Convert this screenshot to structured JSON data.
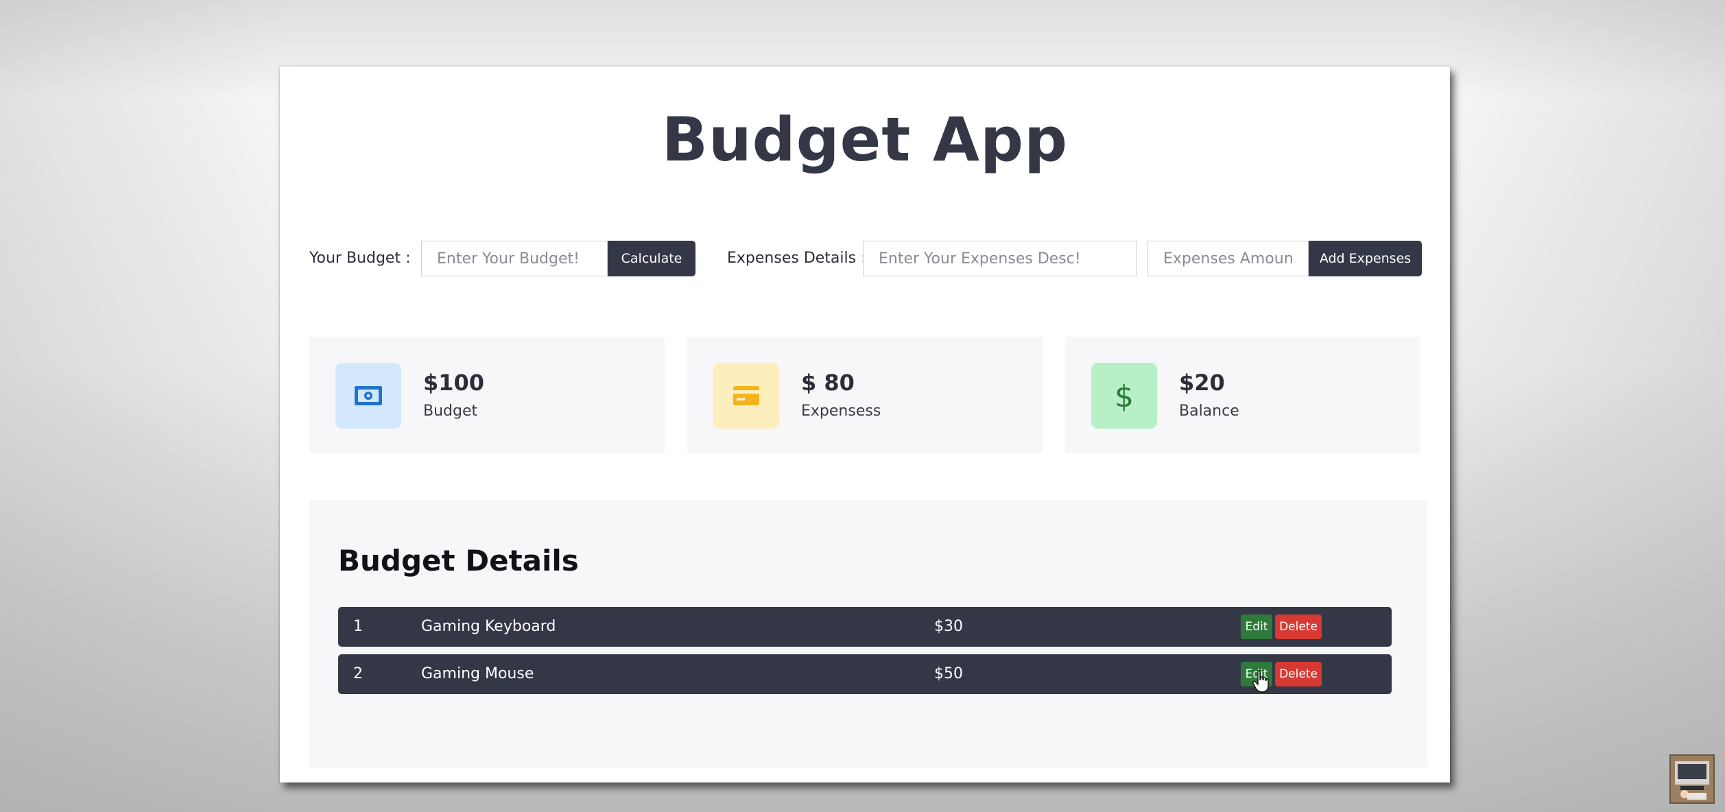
{
  "app": {
    "title": "Budget App"
  },
  "form": {
    "budget_label": "Your Budget :",
    "budget_placeholder": "Enter Your Budget!",
    "calculate_label": "Calculate",
    "expenses_label": "Expenses Details :",
    "expenses_desc_placeholder": "Enter Your Expenses Desc!",
    "expenses_amount_placeholder": "Expenses Amount!",
    "add_expenses_label": "Add Expenses"
  },
  "stats": [
    {
      "value": "$100",
      "caption": "Budget",
      "icon": "money-bill-icon",
      "color": "#1e74c9",
      "bg": "#d3e8fc"
    },
    {
      "value": "$ 80",
      "caption": "Expensess",
      "icon": "credit-card-icon",
      "color": "#f3b41b",
      "bg": "#fdeebe"
    },
    {
      "value": "$20",
      "caption": "Balance",
      "icon": "dollar-sign-icon",
      "color": "#2b7a3a",
      "bg": "#b7efc7"
    }
  ],
  "details": {
    "title": "Budget Details",
    "edit_label": "Edit",
    "delete_label": "Delete",
    "rows": [
      {
        "index": "1",
        "name": "Gaming Keyboard",
        "amount": "$30"
      },
      {
        "index": "2",
        "name": "Gaming Mouse",
        "amount": "$50"
      }
    ]
  }
}
